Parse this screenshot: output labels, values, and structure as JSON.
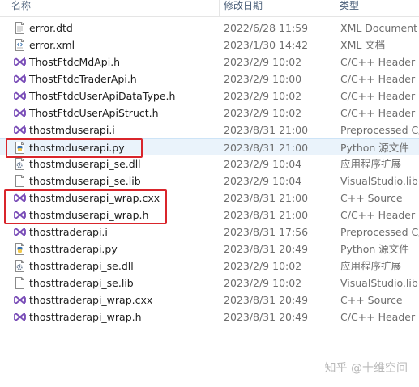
{
  "columns": {
    "name": "名称",
    "date": "修改日期",
    "type": "类型"
  },
  "files": [
    {
      "name": "error.dtd",
      "date": "2022/6/28 11:59",
      "type": "XML Document ...",
      "icon": "document-icon"
    },
    {
      "name": "error.xml",
      "date": "2023/1/30 14:42",
      "type": "XML 文档",
      "icon": "xml-document-icon"
    },
    {
      "name": "ThostFtdcMdApi.h",
      "date": "2023/2/9 10:02",
      "type": "C/C++ Header",
      "icon": "visual-studio-icon"
    },
    {
      "name": "ThostFtdcTraderApi.h",
      "date": "2023/2/9 10:00",
      "type": "C/C++ Header",
      "icon": "visual-studio-icon"
    },
    {
      "name": "ThostFtdcUserApiDataType.h",
      "date": "2023/2/9 10:02",
      "type": "C/C++ Header",
      "icon": "visual-studio-icon"
    },
    {
      "name": "ThostFtdcUserApiStruct.h",
      "date": "2023/2/9 10:02",
      "type": "C/C++ Header",
      "icon": "visual-studio-icon"
    },
    {
      "name": "thostmduserapi.i",
      "date": "2023/8/31 21:00",
      "type": "Preprocessed C/",
      "icon": "visual-studio-icon"
    },
    {
      "name": "thostmduserapi.py",
      "date": "2023/8/31 21:00",
      "type": "Python 源文件",
      "icon": "python-file-icon"
    },
    {
      "name": "thostmduserapi_se.dll",
      "date": "2023/2/9 10:04",
      "type": "应用程序扩展",
      "icon": "dll-gear-icon"
    },
    {
      "name": "thostmduserapi_se.lib",
      "date": "2023/2/9 10:04",
      "type": "VisualStudio.lib...",
      "icon": "blank-file-icon"
    },
    {
      "name": "thostmduserapi_wrap.cxx",
      "date": "2023/8/31 21:00",
      "type": "C++ Source",
      "icon": "visual-studio-icon"
    },
    {
      "name": "thostmduserapi_wrap.h",
      "date": "2023/8/31 21:00",
      "type": "C/C++ Header",
      "icon": "visual-studio-icon"
    },
    {
      "name": "thosttraderapi.i",
      "date": "2023/8/31 17:56",
      "type": "Preprocessed C/",
      "icon": "visual-studio-icon"
    },
    {
      "name": "thosttraderapi.py",
      "date": "2023/8/31 20:49",
      "type": "Python 源文件",
      "icon": "python-file-icon"
    },
    {
      "name": "thosttraderapi_se.dll",
      "date": "2023/2/9 10:02",
      "type": "应用程序扩展",
      "icon": "dll-gear-icon"
    },
    {
      "name": "thosttraderapi_se.lib",
      "date": "2023/2/9 10:02",
      "type": "VisualStudio.lib...",
      "icon": "blank-file-icon"
    },
    {
      "name": "thosttraderapi_wrap.cxx",
      "date": "2023/8/31 20:49",
      "type": "C++ Source",
      "icon": "visual-studio-icon"
    },
    {
      "name": "thosttraderapi_wrap.h",
      "date": "2023/8/31 20:49",
      "type": "C/C++ Header",
      "icon": "visual-studio-icon"
    }
  ],
  "selected_file": "thostmduserapi.py",
  "highlighted_files": [
    "thostmduserapi.py",
    "thostmduserapi_wrap.cxx",
    "thostmduserapi_wrap.h"
  ],
  "watermark": "知乎 @十维空间",
  "colors": {
    "highlight_box": "#d9252b",
    "selection_bg": "#eaf3fb",
    "visual_studio": "#7b4fb8",
    "python_blue": "#3a73b0"
  }
}
